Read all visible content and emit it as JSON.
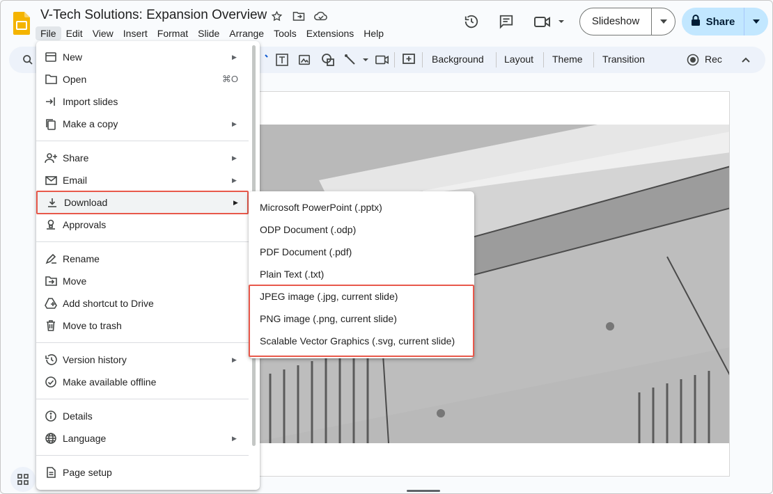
{
  "document": {
    "title": "V-Tech Solutions: Expansion Overview"
  },
  "menubar": [
    {
      "label": "File",
      "active": true
    },
    {
      "label": "Edit"
    },
    {
      "label": "View"
    },
    {
      "label": "Insert"
    },
    {
      "label": "Format"
    },
    {
      "label": "Slide"
    },
    {
      "label": "Arrange"
    },
    {
      "label": "Tools"
    },
    {
      "label": "Extensions"
    },
    {
      "label": "Help"
    }
  ],
  "header": {
    "slideshow_label": "Slideshow",
    "share_label": "Share"
  },
  "toolbar": {
    "background_label": "Background",
    "layout_label": "Layout",
    "theme_label": "Theme",
    "transition_label": "Transition",
    "rec_label": "Rec"
  },
  "file_menu": {
    "items": [
      {
        "label": "New",
        "icon": "new-slides-icon",
        "submenu": true
      },
      {
        "label": "Open",
        "icon": "folder-icon",
        "shortcut": "⌘O"
      },
      {
        "label": "Import slides",
        "icon": "import-icon"
      },
      {
        "label": "Make a copy",
        "icon": "copy-icon",
        "submenu": true
      },
      {
        "label": "Share",
        "icon": "person-add-icon",
        "submenu": true
      },
      {
        "label": "Email",
        "icon": "mail-icon",
        "submenu": true
      },
      {
        "label": "Download",
        "icon": "download-icon",
        "submenu": true,
        "highlighted": true
      },
      {
        "label": "Approvals",
        "icon": "approval-icon"
      },
      {
        "label": "Rename",
        "icon": "rename-icon"
      },
      {
        "label": "Move",
        "icon": "move-folder-icon"
      },
      {
        "label": "Add shortcut to Drive",
        "icon": "drive-shortcut-icon"
      },
      {
        "label": "Move to trash",
        "icon": "trash-icon"
      },
      {
        "label": "Version history",
        "icon": "history-icon",
        "submenu": true
      },
      {
        "label": "Make available offline",
        "icon": "offline-icon"
      },
      {
        "label": "Details",
        "icon": "info-icon"
      },
      {
        "label": "Language",
        "icon": "globe-icon",
        "submenu": true
      },
      {
        "label": "Page setup",
        "icon": "page-icon"
      }
    ]
  },
  "download_menu": {
    "items": [
      {
        "label": "Microsoft PowerPoint (.pptx)"
      },
      {
        "label": "ODP Document (.odp)"
      },
      {
        "label": "PDF Document (.pdf)"
      },
      {
        "label": "Plain Text (.txt)"
      },
      {
        "label": "JPEG image (.jpg, current slide)"
      },
      {
        "label": "PNG image (.png, current slide)"
      },
      {
        "label": "Scalable Vector Graphics (.svg, current slide)"
      }
    ]
  },
  "colors": {
    "highlight_border": "#e8584a",
    "share_bg": "#c2e7ff",
    "toolbar_bg": "#edf2fa",
    "slides_logo": "#f4b400"
  }
}
